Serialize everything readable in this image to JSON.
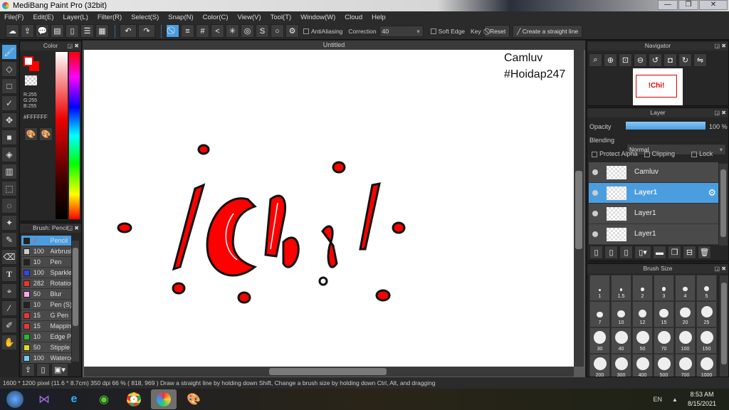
{
  "window": {
    "title": "MediBang Paint Pro (32bit)",
    "minimize": "—",
    "restore": "❐",
    "close": "✕"
  },
  "menu": [
    "File(F)",
    "Edit(E)",
    "Layer(L)",
    "Filter(R)",
    "Select(S)",
    "Snap(N)",
    "Color(C)",
    "View(V)",
    "Tool(T)",
    "Window(W)",
    "Cloud",
    "Help"
  ],
  "toolbar": {
    "antialiasing": "AntiAliasing",
    "correction_label": "Correction",
    "correction_value": "40",
    "soft_edge": "Soft Edge",
    "key": "Key",
    "reset": "Reset",
    "straight_line": "Create a straight line"
  },
  "color": {
    "title": "Color",
    "r": "R:255",
    "g": "G:255",
    "b": "B:255",
    "hex": "#FFFFFF",
    "primary": "#FFFFFF",
    "secondary": "#FF0000"
  },
  "brush": {
    "title": "Brush: Pencil",
    "items": [
      {
        "size": "4",
        "name": "Pencil",
        "color": "#222222"
      },
      {
        "size": "100",
        "name": "Airbrush",
        "color": "#cccccc"
      },
      {
        "size": "10",
        "name": "Pen",
        "color": "#222222"
      },
      {
        "size": "100",
        "name": "Sparkle",
        "color": "#3344ee"
      },
      {
        "size": "282",
        "name": "Rotation",
        "color": "#ee3333"
      },
      {
        "size": "50",
        "name": "Blur",
        "color": "#f5a8f0"
      },
      {
        "size": "10",
        "name": "Pen (S)",
        "color": "#222222"
      },
      {
        "size": "15",
        "name": "G Pen",
        "color": "#ee3333"
      },
      {
        "size": "15",
        "name": "Mapping",
        "color": "#ee3333"
      },
      {
        "size": "10",
        "name": "Edge Pen",
        "color": "#22bb22"
      },
      {
        "size": "50",
        "name": "Stipple",
        "color": "#dddd22"
      },
      {
        "size": "100",
        "name": "Watercolor",
        "color": "#77ccee"
      }
    ]
  },
  "document": {
    "tab": "Untitled",
    "text_line1": "Camluv",
    "text_line2": "#Hoidap247"
  },
  "navigator": {
    "title": "Navigator"
  },
  "layer": {
    "title": "Layer",
    "opacity_label": "Opacity",
    "opacity_value": "100 %",
    "opacity": 100,
    "blending_label": "Blending",
    "blending_value": "Normal",
    "protect_alpha": "Protect Alpha",
    "clipping": "Clipping",
    "lock": "Lock",
    "layers": [
      {
        "name": "Camluv",
        "selected": false
      },
      {
        "name": "Layer1",
        "selected": true
      },
      {
        "name": "Layer1",
        "selected": false
      },
      {
        "name": "Layer1",
        "selected": false
      }
    ]
  },
  "brush_size": {
    "title": "Brush Size",
    "sizes": [
      "1",
      "1.5",
      "2",
      "3",
      "4",
      "5",
      "7",
      "10",
      "12",
      "15",
      "20",
      "25",
      "30",
      "40",
      "50",
      "70",
      "100",
      "150",
      "200",
      "300",
      "400",
      "500",
      "700",
      "1000"
    ]
  },
  "status": {
    "text": "1600 * 1200 pixel  (11.6 * 8.7cm)  350 dpi  66 %  ( 818, 969 )  Draw a straight line by holding down Shift, Change a brush size by holding down Ctrl, Alt, and dragging"
  },
  "taskbar": {
    "lang": "EN",
    "time": "8:53 AM",
    "date": "8/15/2021"
  }
}
